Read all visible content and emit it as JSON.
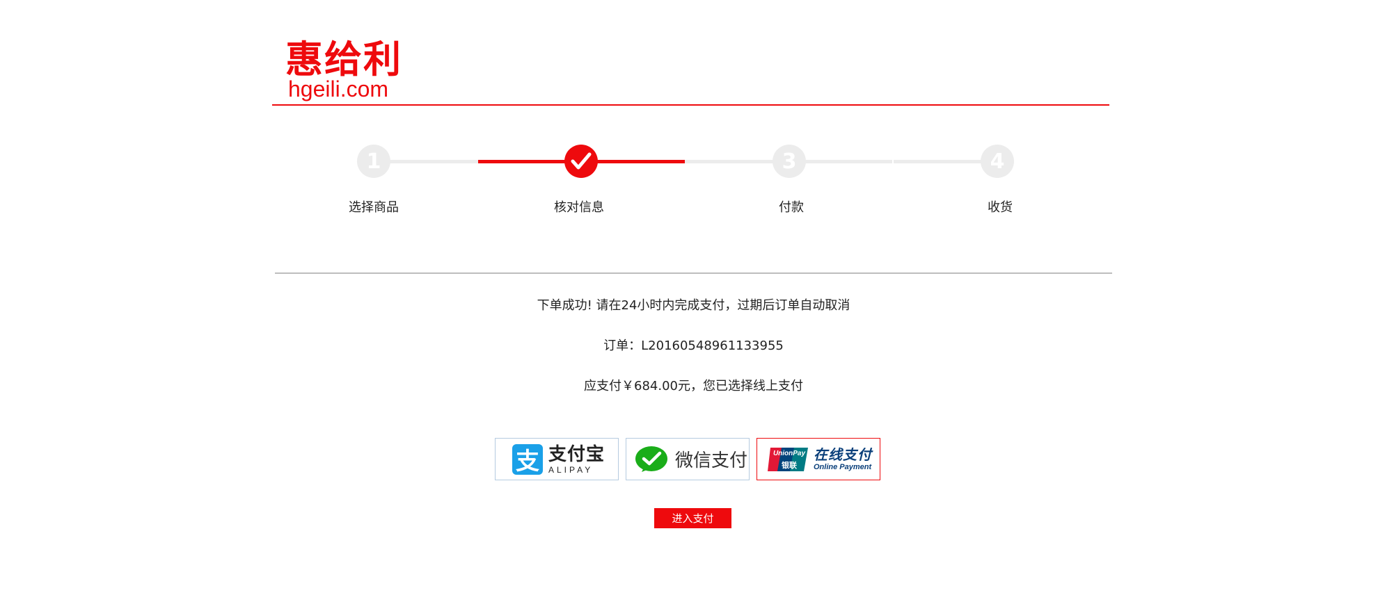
{
  "brand": {
    "name_cn": "惠给利",
    "domain": "hgeili.com",
    "color": "#ee0a0d"
  },
  "steps": [
    {
      "number": "1",
      "label": "选择商品",
      "state": "pending"
    },
    {
      "number": "",
      "label": "核对信息",
      "state": "done",
      "icon": "check-icon"
    },
    {
      "number": "3",
      "label": "付款",
      "state": "pending"
    },
    {
      "number": "4",
      "label": "收货",
      "state": "pending"
    }
  ],
  "order": {
    "success_message": "下单成功! 请在24小时内完成支付，过期后订单自动取消",
    "order_number_line": "订单：L20160548961133955",
    "amount_line": "应支付￥684.00元，您已选择线上支付"
  },
  "payment_methods": {
    "alipay": {
      "cn": "支付宝",
      "en": "ALIPAY",
      "icon": "alipay-icon",
      "glyph": "支"
    },
    "wechat": {
      "cn": "微信支付",
      "icon": "wechat-pay-icon"
    },
    "unionpay": {
      "cn": "在线支付",
      "en": "Online Payment",
      "icon": "unionpay-icon",
      "logo_text": "UnionPay",
      "logo_cn": "银联",
      "selected": true
    }
  },
  "actions": {
    "pay_button_label": "进入支付"
  },
  "colors": {
    "accent": "#ee0a0d",
    "inactive_step": "#ececec",
    "alipay_blue": "#1aa0e8",
    "wechat_green": "#1aad19",
    "unionpay_navy": "#0a3f7a"
  }
}
